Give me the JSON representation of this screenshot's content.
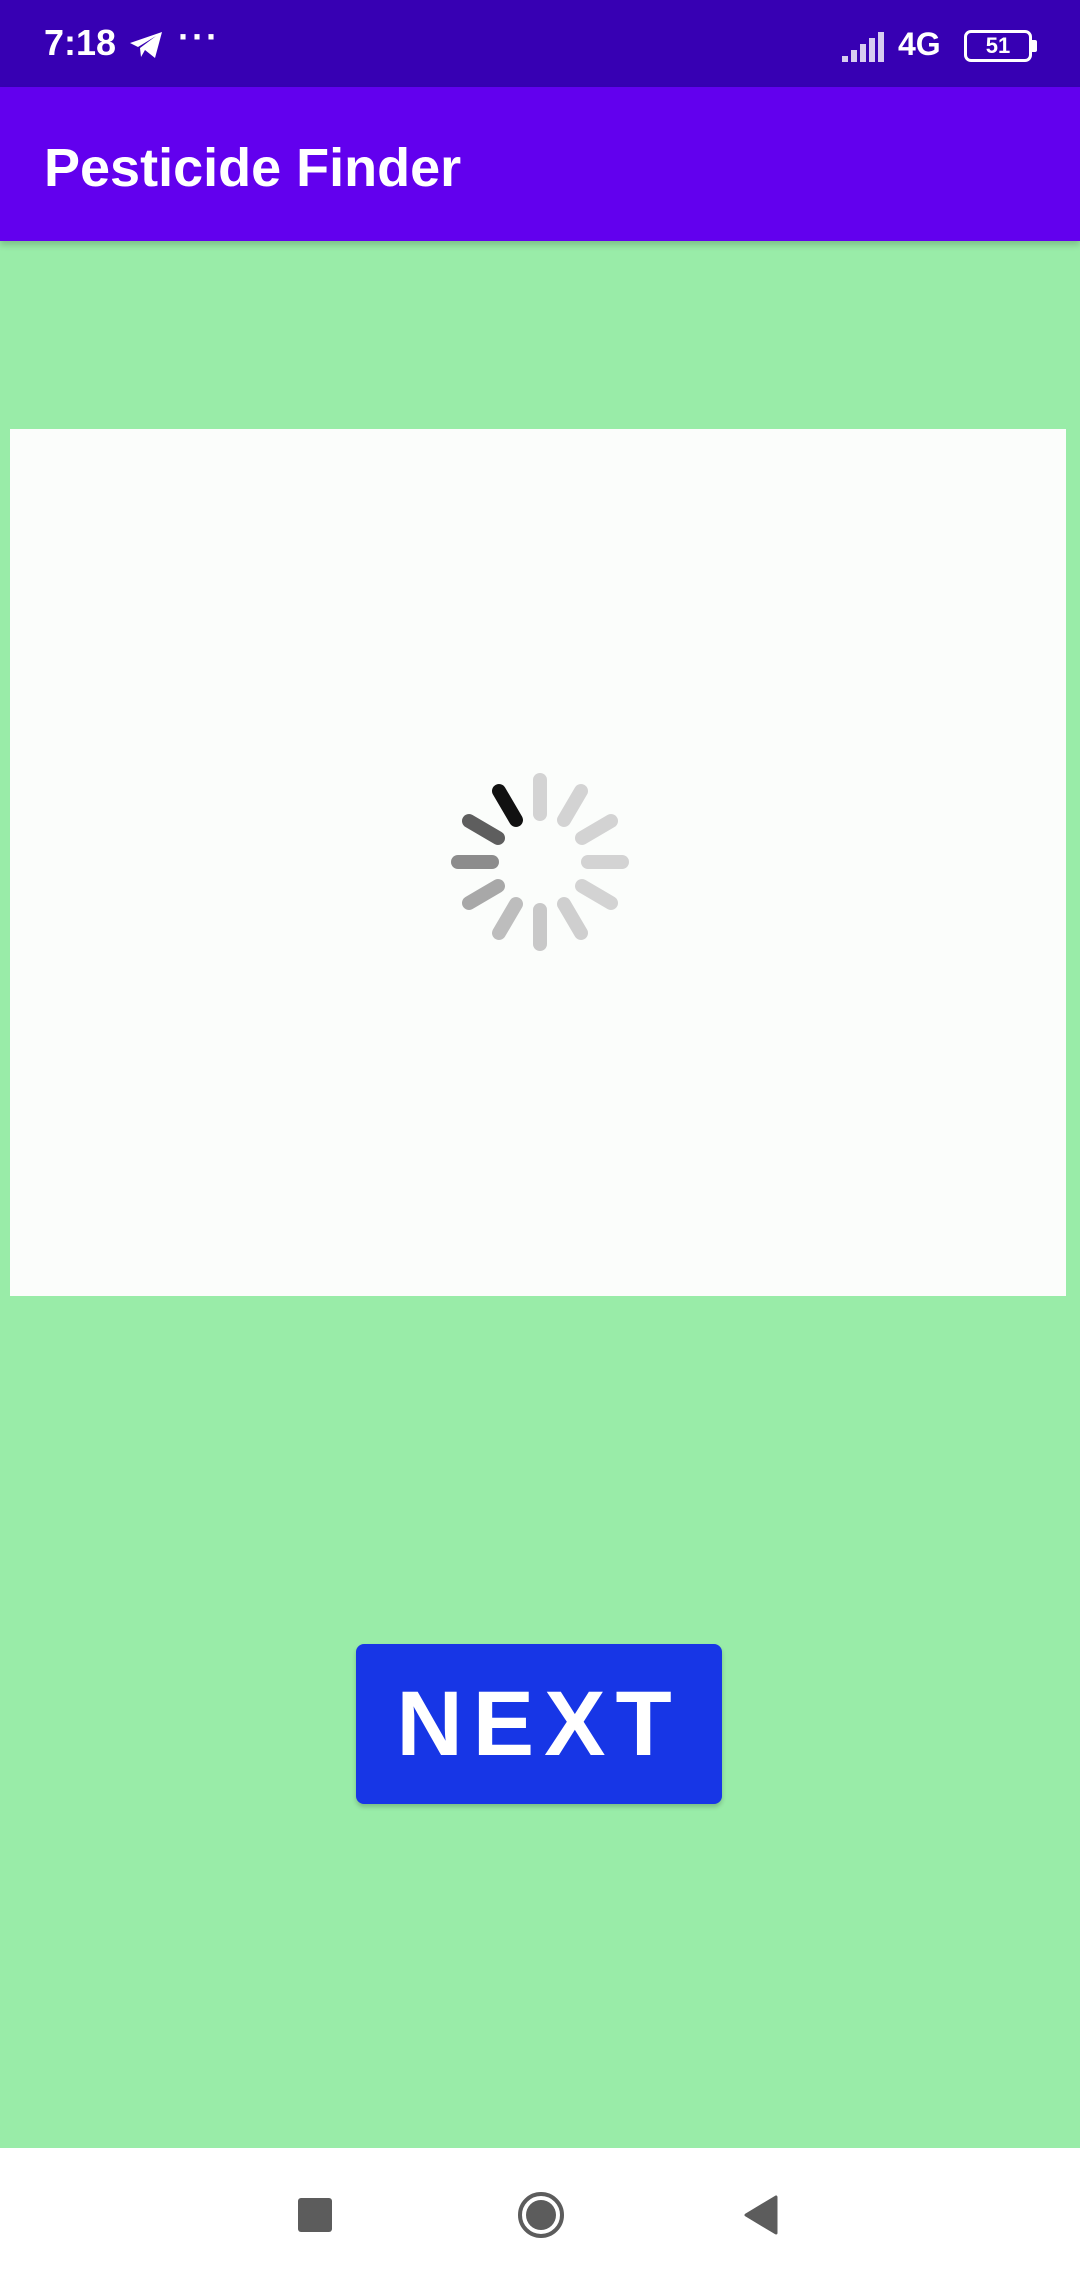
{
  "status_bar": {
    "time": "7:18",
    "more": "···",
    "network": "4G",
    "battery": "51",
    "icons": [
      "telegram-icon",
      "signal-icon",
      "battery-icon"
    ]
  },
  "app_bar": {
    "title": "Pesticide Finder"
  },
  "content": {
    "loading_icon": "loading-spinner-icon",
    "next_button_label": "NEXT"
  },
  "nav_bar": {
    "icons": [
      "recents-icon",
      "home-icon",
      "back-icon"
    ]
  },
  "colors": {
    "status_bar": "#3700B3",
    "app_bar": "#6200EE",
    "background": "#99ECA8",
    "button": "#1736E6"
  }
}
